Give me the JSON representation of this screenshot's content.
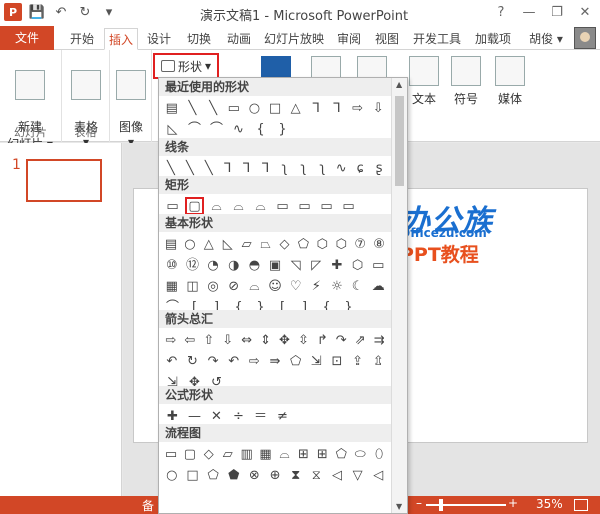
{
  "window": {
    "title": "演示文稿1 - Microsoft PowerPoint",
    "app_icon": "P",
    "help": "?",
    "minimize": "—",
    "restore": "❐",
    "close": "✕"
  },
  "qat": {
    "save": "💾",
    "undo": "↶",
    "redo": "↻",
    "customize": "▾"
  },
  "tabs": [
    {
      "label": "文件"
    },
    {
      "label": "开始"
    },
    {
      "label": "插入"
    },
    {
      "label": "设计"
    },
    {
      "label": "切换"
    },
    {
      "label": "动画"
    },
    {
      "label": "幻灯片放映"
    },
    {
      "label": "审阅"
    },
    {
      "label": "视图"
    },
    {
      "label": "开发工具"
    },
    {
      "label": "加载项"
    },
    {
      "label": "胡俊 ▾"
    }
  ],
  "ribbon": {
    "new_slide": "新建\n幻灯片 ▾",
    "new_slide_group": "幻灯片",
    "table": "表格\n▾",
    "table_group": "表格",
    "image": "图像\n▾",
    "shapes": "形状",
    "text": "文本",
    "symbol": "符号",
    "media": "媒体"
  },
  "thumbnail": {
    "number": "1"
  },
  "gallery": {
    "sections": [
      {
        "title": "最近使用的形状",
        "rows": [
          [
            "▤",
            "╲",
            "╲",
            "▭",
            "○",
            "□",
            "△",
            "⅂",
            "⅂",
            "⇨",
            "⇩"
          ],
          [
            "◺",
            "⌒",
            "⌒",
            "∿",
            "{",
            "}"
          ]
        ]
      },
      {
        "title": "线条",
        "rows": [
          [
            "╲",
            "╲",
            "╲",
            "⅂",
            "⅂",
            "⅂",
            "ʅ",
            "ʅ",
            "ʅ",
            "∿",
            "ɕ",
            "ʂ"
          ]
        ]
      },
      {
        "title": "矩形",
        "rows": [
          [
            "▭",
            "▢",
            "⌓",
            "⌓",
            "⌓",
            "▭",
            "▭",
            "▭",
            "▭"
          ]
        ]
      },
      {
        "title": "基本形状",
        "rows": [
          [
            "▤",
            "○",
            "△",
            "◺",
            "▱",
            "⏢",
            "◇",
            "⬠",
            "⬡",
            "⬡",
            "⑦",
            "⑧"
          ],
          [
            "⑩",
            "⑫",
            "◔",
            "◑",
            "◓",
            "▣",
            "◹",
            "◸",
            "✚",
            "⬡",
            "▭"
          ],
          [
            "▦",
            "◫",
            "◎",
            "⊘",
            "⌓",
            "☺",
            "♡",
            "⚡",
            "☼",
            "☾",
            "☁"
          ],
          [
            "⌒",
            "[",
            "]",
            "{",
            "}",
            "[",
            "]",
            "{",
            "}"
          ]
        ]
      },
      {
        "title": "箭头总汇",
        "rows": [
          [
            "⇨",
            "⇦",
            "⇧",
            "⇩",
            "⇔",
            "⇕",
            "✥",
            "⇳",
            "↱",
            "↷",
            "⇗",
            "⇉"
          ],
          [
            "↶",
            "↻",
            "↷",
            "↶",
            "⇨",
            "⇛",
            "⬠",
            "⇲",
            "⊡",
            "⇪",
            "⇫"
          ],
          [
            "⇲",
            "✥",
            "↺"
          ]
        ]
      },
      {
        "title": "公式形状",
        "rows": [
          [
            "✚",
            "—",
            "✕",
            "÷",
            "＝",
            "≠"
          ]
        ]
      },
      {
        "title": "流程图",
        "rows": [
          [
            "▭",
            "▢",
            "◇",
            "▱",
            "▥",
            "▦",
            "⌓",
            "⊞",
            "⊞",
            "⬠",
            "⬭",
            "⬯"
          ],
          [
            "○",
            "□",
            "⬠",
            "⬟",
            "⊗",
            "⊕",
            "⧗",
            "⧖",
            "◁",
            "▽",
            "◁"
          ]
        ]
      }
    ]
  },
  "watermark": {
    "main": "办公族",
    "url": "Officezu.com",
    "ppt": "PPT教程"
  },
  "status": {
    "left": "备",
    "zoom": "35%",
    "zoom_minus": "–",
    "zoom_plus": "+"
  },
  "colors": {
    "accent": "#d24726",
    "highlight_box": "#e02020",
    "watermark_blue": "#1a6fd0",
    "watermark_orange": "#e8501e"
  }
}
